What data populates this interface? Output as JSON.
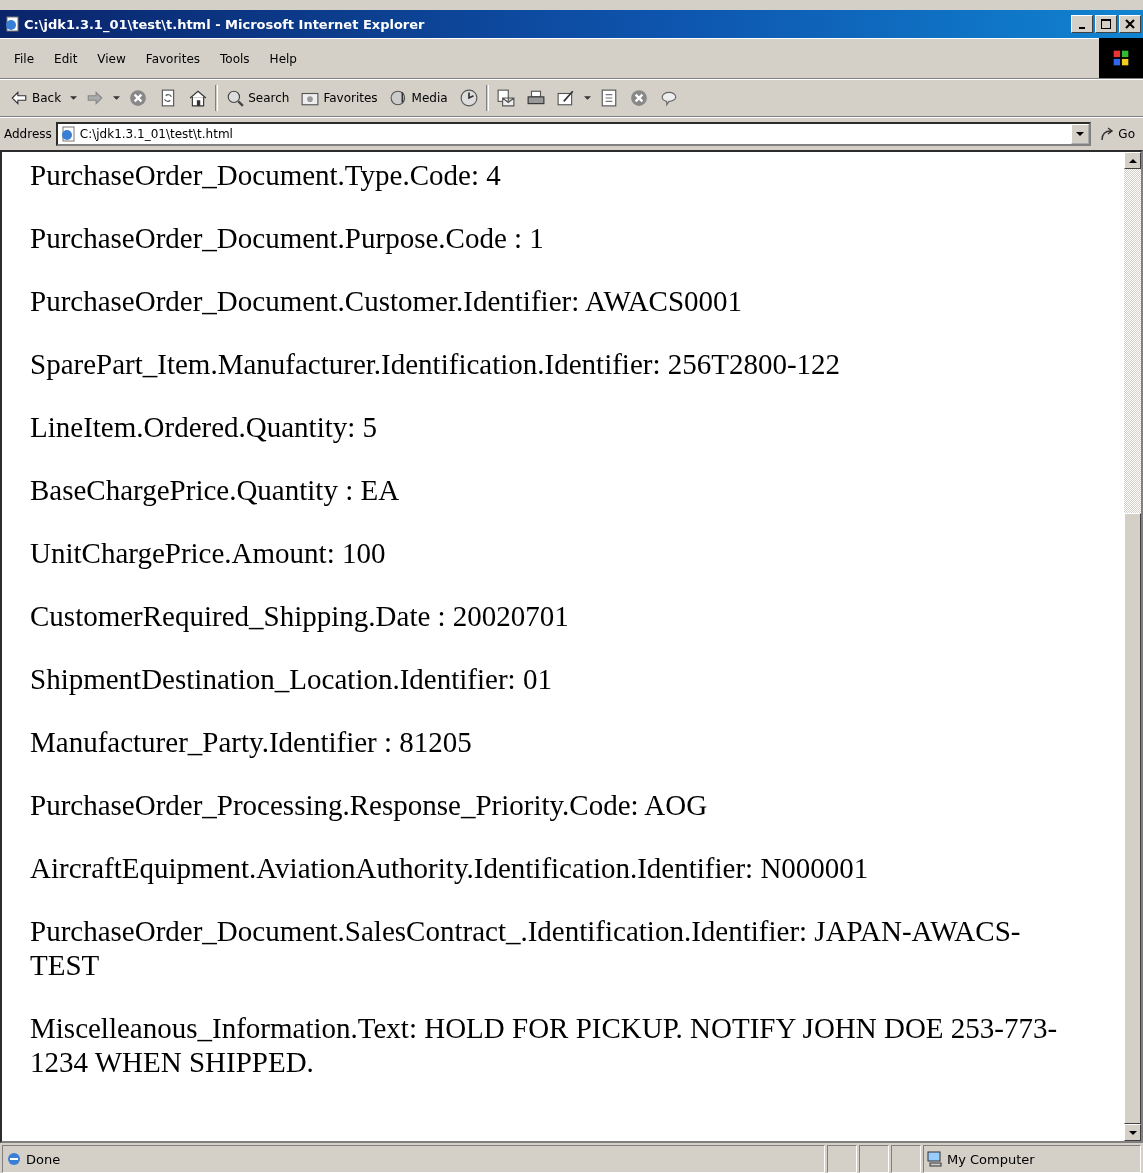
{
  "window": {
    "title": "C:\\jdk1.3.1_01\\test\\t.html - Microsoft Internet Explorer"
  },
  "menu": [
    "File",
    "Edit",
    "View",
    "Favorites",
    "Tools",
    "Help"
  ],
  "toolbar": [
    {
      "kind": "back",
      "label": "Back"
    },
    {
      "kind": "dropdown"
    },
    {
      "kind": "forward"
    },
    {
      "kind": "dropdown"
    },
    {
      "kind": "stop"
    },
    {
      "kind": "refresh"
    },
    {
      "kind": "home"
    },
    {
      "kind": "separator"
    },
    {
      "kind": "search",
      "label": "Search"
    },
    {
      "kind": "favorites",
      "label": "Favorites"
    },
    {
      "kind": "media",
      "label": "Media"
    },
    {
      "kind": "history"
    },
    {
      "kind": "separator"
    },
    {
      "kind": "mail"
    },
    {
      "kind": "print"
    },
    {
      "kind": "edit"
    },
    {
      "kind": "dropdown"
    },
    {
      "kind": "discuss"
    },
    {
      "kind": "stop"
    },
    {
      "kind": "messenger"
    }
  ],
  "address": {
    "label": "Address",
    "value": "C:\\jdk1.3.1_01\\test\\t.html",
    "go": "Go"
  },
  "content": [
    "PurchaseOrder_Document.Type.Code: 4",
    "PurchaseOrder_Document.Purpose.Code : 1",
    "PurchaseOrder_Document.Customer.Identifier: AWACS0001",
    "SparePart_Item.Manufacturer.Identification.Identifier: 256T2800-122",
    "LineItem.Ordered.Quantity: 5",
    "BaseChargePrice.Quantity : EA",
    "UnitChargePrice.Amount: 100",
    "CustomerRequired_Shipping.Date : 20020701",
    "ShipmentDestination_Location.Identifier: 01",
    "Manufacturer_Party.Identifier : 81205",
    "PurchaseOrder_Processing.Response_Priority.Code: AOG",
    "AircraftEquipment.AviationAuthority.Identification.Identifier: N000001",
    "PurchaseOrder_Document.SalesContract_.Identification.Identifier: JAPAN-AWACS-TEST",
    "Miscelleanous_Information.Text: HOLD FOR PICKUP. NOTIFY JOHN DOE 253-773-1234 WHEN SHIPPED."
  ],
  "status_bar": {
    "text": "Done",
    "zone": "My Computer"
  }
}
